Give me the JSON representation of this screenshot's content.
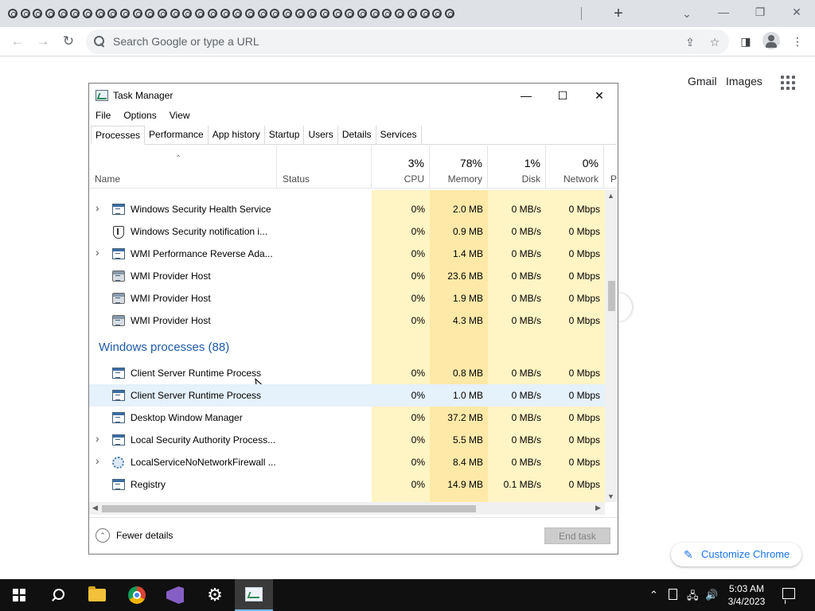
{
  "browser": {
    "tab_count": 36,
    "new_tab_symbol": "+",
    "omnibox_placeholder": "Search Google or type a URL",
    "window_controls": {
      "minimize": "—",
      "restore": "❐",
      "close": "✕"
    },
    "icons": [
      "back-icon",
      "forward-icon",
      "reload-icon",
      "share-icon",
      "bookmark-star-icon",
      "side-panel-icon",
      "profile-icon",
      "menu-kebab-icon"
    ]
  },
  "google": {
    "gmail": "Gmail",
    "images": "Images",
    "customize": "Customize Chrome"
  },
  "task_manager": {
    "title": "Task Manager",
    "menu": [
      "File",
      "Options",
      "View"
    ],
    "tabs": [
      "Processes",
      "Performance",
      "App history",
      "Startup",
      "Users",
      "Details",
      "Services"
    ],
    "active_tab": "Processes",
    "columns": {
      "name": "Name",
      "status": "Status",
      "cpu": {
        "pct": "3%",
        "label": "CPU"
      },
      "memory": {
        "pct": "78%",
        "label": "Memory"
      },
      "disk": {
        "pct": "1%",
        "label": "Disk"
      },
      "network": {
        "pct": "0%",
        "label": "Network"
      },
      "power_partial": "P"
    },
    "rows": [
      {
        "name": "Windows Security Health Service",
        "cpu": "0%",
        "memory": "2.0 MB",
        "disk": "0 MB/s",
        "network": "0 Mbps",
        "expandable": true,
        "icon": "service-icon"
      },
      {
        "name": "Windows Security notification i...",
        "cpu": "0%",
        "memory": "0.9 MB",
        "disk": "0 MB/s",
        "network": "0 Mbps",
        "expandable": false,
        "icon": "shield-icon"
      },
      {
        "name": "WMI Performance Reverse Ada...",
        "cpu": "0%",
        "memory": "1.4 MB",
        "disk": "0 MB/s",
        "network": "0 Mbps",
        "expandable": true,
        "icon": "service-icon"
      },
      {
        "name": "WMI Provider Host",
        "cpu": "0%",
        "memory": "23.6 MB",
        "disk": "0 MB/s",
        "network": "0 Mbps",
        "expandable": false,
        "icon": "host-icon"
      },
      {
        "name": "WMI Provider Host",
        "cpu": "0%",
        "memory": "1.9 MB",
        "disk": "0 MB/s",
        "network": "0 Mbps",
        "expandable": false,
        "icon": "host-icon"
      },
      {
        "name": "WMI Provider Host",
        "cpu": "0%",
        "memory": "4.3 MB",
        "disk": "0 MB/s",
        "network": "0 Mbps",
        "expandable": false,
        "icon": "host-icon"
      }
    ],
    "group_title": "Windows processes (88)",
    "group_rows": [
      {
        "name": "Client Server Runtime Process",
        "cpu": "0%",
        "memory": "0.8 MB",
        "disk": "0 MB/s",
        "network": "0 Mbps",
        "expandable": false,
        "icon": "service-icon"
      },
      {
        "name": "Client Server Runtime Process",
        "cpu": "0%",
        "memory": "1.0 MB",
        "disk": "0 MB/s",
        "network": "0 Mbps",
        "expandable": false,
        "icon": "service-icon"
      },
      {
        "name": "Desktop Window Manager",
        "cpu": "0%",
        "memory": "37.2 MB",
        "disk": "0 MB/s",
        "network": "0 Mbps",
        "expandable": false,
        "icon": "service-icon"
      },
      {
        "name": "Local Security Authority Process...",
        "cpu": "0%",
        "memory": "5.5 MB",
        "disk": "0 MB/s",
        "network": "0 Mbps",
        "expandable": true,
        "icon": "service-icon"
      },
      {
        "name": "LocalServiceNoNetworkFirewall ...",
        "cpu": "0%",
        "memory": "8.4 MB",
        "disk": "0 MB/s",
        "network": "0 Mbps",
        "expandable": true,
        "icon": "gear-icon"
      },
      {
        "name": "Registry",
        "cpu": "0%",
        "memory": "14.9 MB",
        "disk": "0.1 MB/s",
        "network": "0 Mbps",
        "expandable": false,
        "icon": "service-icon"
      }
    ],
    "hover_row_index": 7,
    "footer": {
      "fewer_details": "Fewer details",
      "end_task": "End task"
    },
    "colors": {
      "heat_light": "#fff4c4",
      "heat_medium": "#ffe9a8",
      "group_title": "#1e5aa8",
      "hover": "#e5f1fb"
    }
  },
  "taskbar": {
    "apps": [
      "start-icon",
      "search-icon",
      "file-explorer-icon",
      "chrome-icon",
      "visual-studio-icon",
      "settings-icon",
      "task-manager-icon"
    ],
    "active_app": "task-manager-icon",
    "tray_icons": [
      "chevron-up-icon",
      "tablet-icon",
      "network-icon",
      "volume-icon"
    ],
    "clock_time": "5:03 AM",
    "clock_date": "3/4/2023"
  }
}
